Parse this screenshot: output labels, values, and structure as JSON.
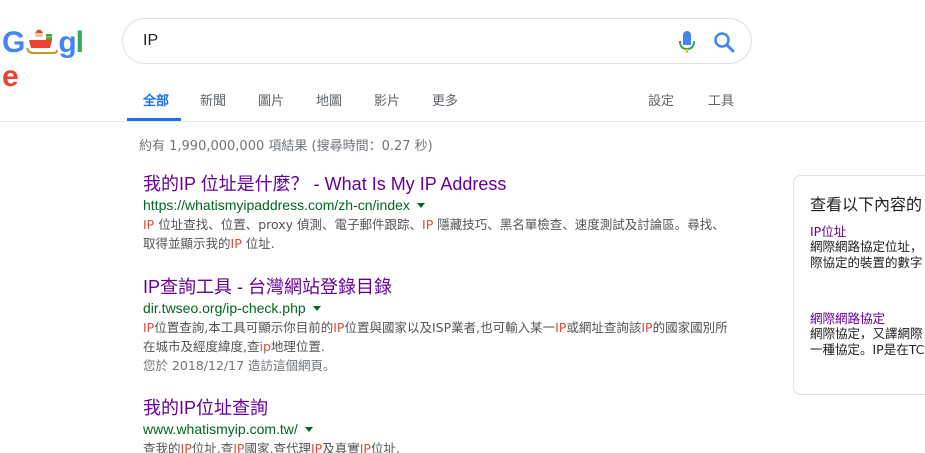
{
  "logo": {
    "letters": [
      "G",
      "",
      "",
      "g",
      "l",
      "e"
    ],
    "colors": {
      "blue": "#4285f4",
      "red": "#ea4335",
      "yellow": "#fbbc05",
      "green": "#34a853"
    }
  },
  "search": {
    "value": "IP",
    "mic_icon": "mic-icon",
    "search_icon": "search-icon"
  },
  "tabs": {
    "all": "全部",
    "news": "新聞",
    "images": "圖片",
    "maps": "地圖",
    "videos": "影片",
    "more": "更多",
    "settings": "設定",
    "tools": "工具"
  },
  "stats": "約有 1,990,000,000 項結果 (搜尋時間：0.27 秒)",
  "results": [
    {
      "title": "我的IP 位址是什麼？ - What Is My IP Address",
      "url": "https://whatismyipaddress.com/zh-cn/index",
      "snippet_parts": [
        [
          "IP",
          true
        ],
        [
          " 位址查找、位置、proxy 偵測、電子郵件跟踪、",
          false
        ],
        [
          "IP",
          true
        ],
        [
          " 隱藏技巧、黑名單檢查、速度測試及討論區。尋",
          false
        ],
        [
          "找、取得並顯示我的",
          false
        ],
        [
          "IP",
          true
        ],
        [
          " 位址.",
          false
        ]
      ]
    },
    {
      "title": "IP查詢工具 - 台灣網站登錄目錄",
      "url": "dir.twseo.org/ip-check.php",
      "snippet_parts": [
        [
          "IP",
          true
        ],
        [
          "位置查詢,本工具可顯示你目前的",
          false
        ],
        [
          "IP",
          true
        ],
        [
          "位置與國家以及ISP業者,也可輸入某一",
          false
        ],
        [
          "IP",
          true
        ],
        [
          "或網址查詢該",
          false
        ],
        [
          "IP",
          true
        ],
        [
          "的國家國",
          false
        ],
        [
          "別所在城市及經度緯度,查",
          false
        ],
        [
          "ip",
          true
        ],
        [
          "地理位置.",
          false
        ]
      ],
      "visited": "您於 2018/12/17 造訪這個網頁。"
    },
    {
      "title": "我的IP位址查詢",
      "url": "www.whatismyip.com.tw/",
      "snippet_parts": [
        [
          "查我的",
          false
        ],
        [
          "IP",
          true
        ],
        [
          "位址,查",
          false
        ],
        [
          "IP",
          true
        ],
        [
          "國家,查代理",
          false
        ],
        [
          "IP",
          true
        ],
        [
          "及真實",
          false
        ],
        [
          "IP",
          true
        ],
        [
          "位址.",
          false
        ]
      ]
    }
  ],
  "knowledge_panel": {
    "title": "查看以下內容的",
    "item1_link": "IP位址",
    "item1_line1": "網際網路協定位址，",
    "item1_line2": "際協定的裝置的數字",
    "item2_link": "網際網路協定",
    "item2_line1": "網際協定，又譯網際",
    "item2_line2": "一種協定。IP是在TC"
  }
}
